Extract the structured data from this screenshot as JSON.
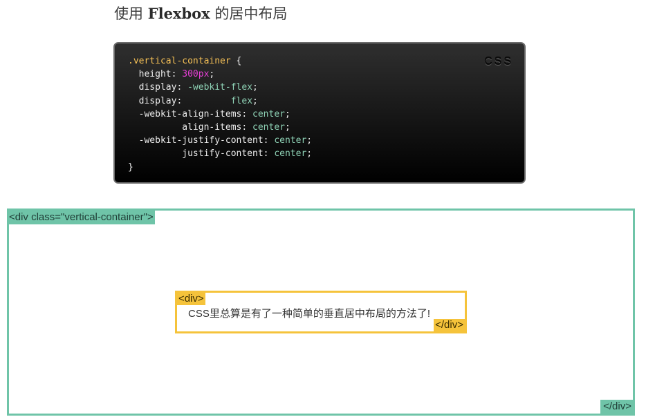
{
  "heading": {
    "prefix": "使用 ",
    "bold": "Flexbox",
    "suffix": " 的居中布局"
  },
  "code_block": {
    "language": "CSS",
    "lines": [
      [
        {
          "text": ".vertical-container",
          "cls": "sel"
        },
        {
          "text": " {",
          "cls": "pln"
        }
      ],
      [
        {
          "text": "  height: ",
          "cls": "pln"
        },
        {
          "text": "300px",
          "cls": "num"
        },
        {
          "text": ";",
          "cls": "pln"
        }
      ],
      [
        {
          "text": "  display: ",
          "cls": "pln"
        },
        {
          "text": "-webkit-flex",
          "cls": "kw"
        },
        {
          "text": ";",
          "cls": "pln"
        }
      ],
      [
        {
          "text": "  display:         ",
          "cls": "pln"
        },
        {
          "text": "flex",
          "cls": "kw"
        },
        {
          "text": ";",
          "cls": "pln"
        }
      ],
      [
        {
          "text": "  -webkit-align-items: ",
          "cls": "pln"
        },
        {
          "text": "center",
          "cls": "kw"
        },
        {
          "text": ";",
          "cls": "pln"
        }
      ],
      [
        {
          "text": "          align-items: ",
          "cls": "pln"
        },
        {
          "text": "center",
          "cls": "kw"
        },
        {
          "text": ";",
          "cls": "pln"
        }
      ],
      [
        {
          "text": "  -webkit-justify-content: ",
          "cls": "pln"
        },
        {
          "text": "center",
          "cls": "kw"
        },
        {
          "text": ";",
          "cls": "pln"
        }
      ],
      [
        {
          "text": "          justify-content: ",
          "cls": "pln"
        },
        {
          "text": "center",
          "cls": "kw"
        },
        {
          "text": ";",
          "cls": "pln"
        }
      ],
      [
        {
          "text": "}",
          "cls": "pln"
        }
      ]
    ]
  },
  "demo": {
    "outer_open_tag": "<div class=\"vertical-container\">",
    "outer_close_tag": "</div>",
    "inner_open_tag": "<div>",
    "inner_close_tag": "</div>",
    "inner_text": "CSS里总算是有了一种简单的垂直居中布局的方法了!"
  },
  "colors": {
    "outer_border": "#6fc4a8",
    "inner_border": "#f5c33b",
    "selector": "#f5c056",
    "number": "#e83fd7",
    "keyword": "#8fd3b6"
  }
}
